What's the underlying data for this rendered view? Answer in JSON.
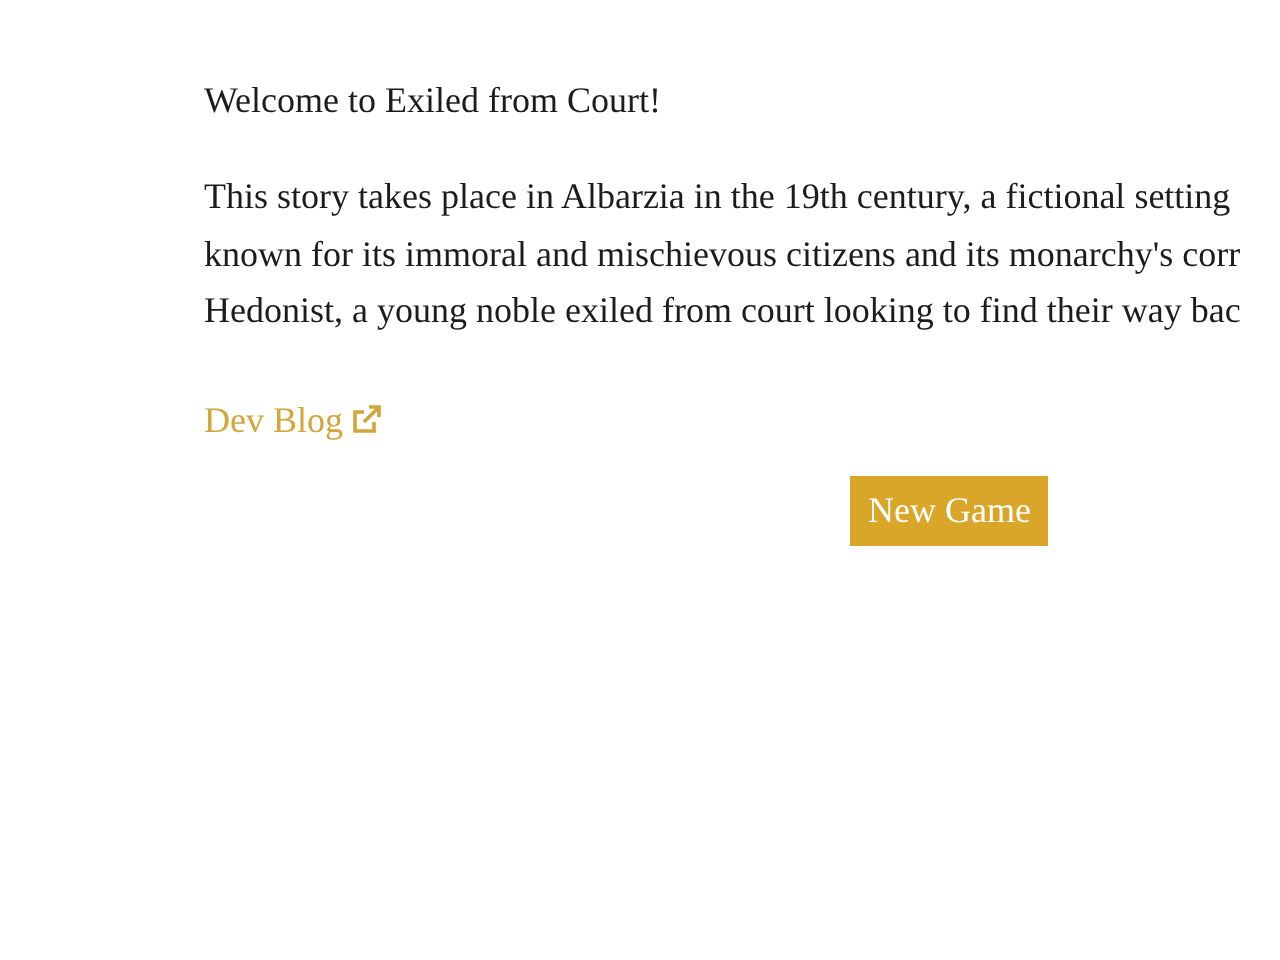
{
  "welcome": "Welcome to Exiled from Court!",
  "story_lines": [
    "This story takes place in Albarzia in the 19th century, a fictional setting",
    "known for its immoral and mischievous citizens and its monarchy's corr",
    "Hedonist, a young noble exiled from court looking to find their way bac"
  ],
  "link": {
    "label": "Dev Blog",
    "external": true
  },
  "button": "New Game"
}
